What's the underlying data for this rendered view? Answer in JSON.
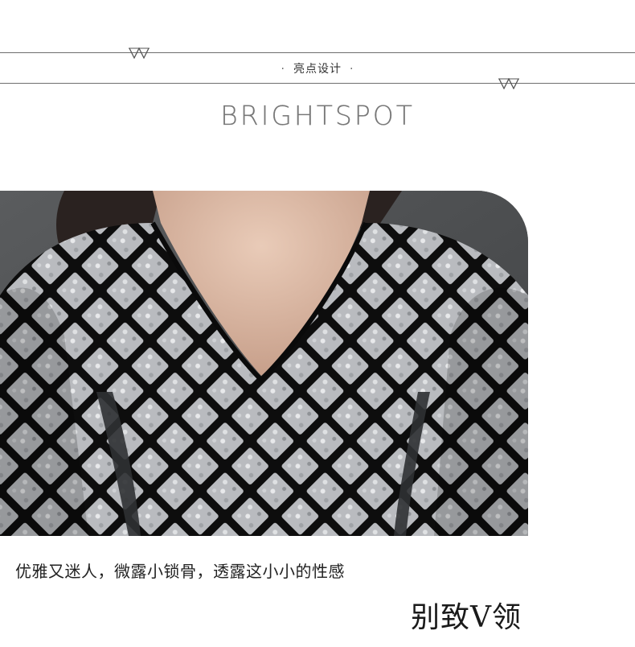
{
  "header": {
    "title": "亮点设计",
    "dot": "·",
    "subtitle": "BRIGHTSPOT"
  },
  "photo": {
    "subject": "sequin-v-neck-dress"
  },
  "caption": {
    "text": "优雅又迷人，微露小锁骨，透露这小小的性感"
  },
  "feature": {
    "label": "别致V领"
  },
  "colors": {
    "rule": "#6e6e6e",
    "background": "#ffffff",
    "photo_backdrop": "#4b4d4f",
    "sequin": "#b7b9bc",
    "lattice": "#111111"
  }
}
